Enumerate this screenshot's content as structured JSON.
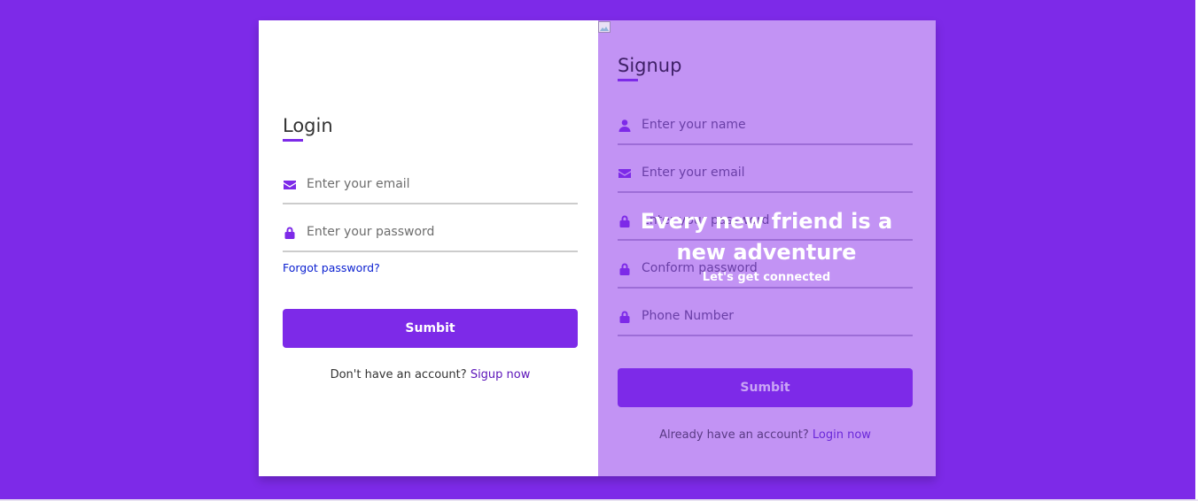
{
  "login": {
    "title": "Login",
    "email_placeholder": "Enter your email",
    "password_placeholder": "Enter your password",
    "forgot_password": "Forgot password?",
    "submit_label": "Sumbit",
    "switch_prompt": "Don't have an account?",
    "switch_link": "Sigup now"
  },
  "signup": {
    "title": "Signup",
    "name_placeholder": "Enter your name",
    "email_placeholder": "Enter your email",
    "password_placeholder": "Enter your password",
    "confirm_placeholder": "Conform password",
    "phone_placeholder": "Phone Number",
    "submit_label": "Sumbit",
    "switch_prompt": "Already have an account?",
    "switch_link": "Login now"
  },
  "cover": {
    "headline": "Every new friend is a new adventure",
    "subtext": "Let's get connected"
  },
  "icons": {
    "email": "envelope-icon",
    "password": "lock-icon",
    "name": "user-icon"
  },
  "colors": {
    "accent": "#7d2ae8",
    "panel": "#c293f4",
    "link": "#0a1fd0"
  }
}
